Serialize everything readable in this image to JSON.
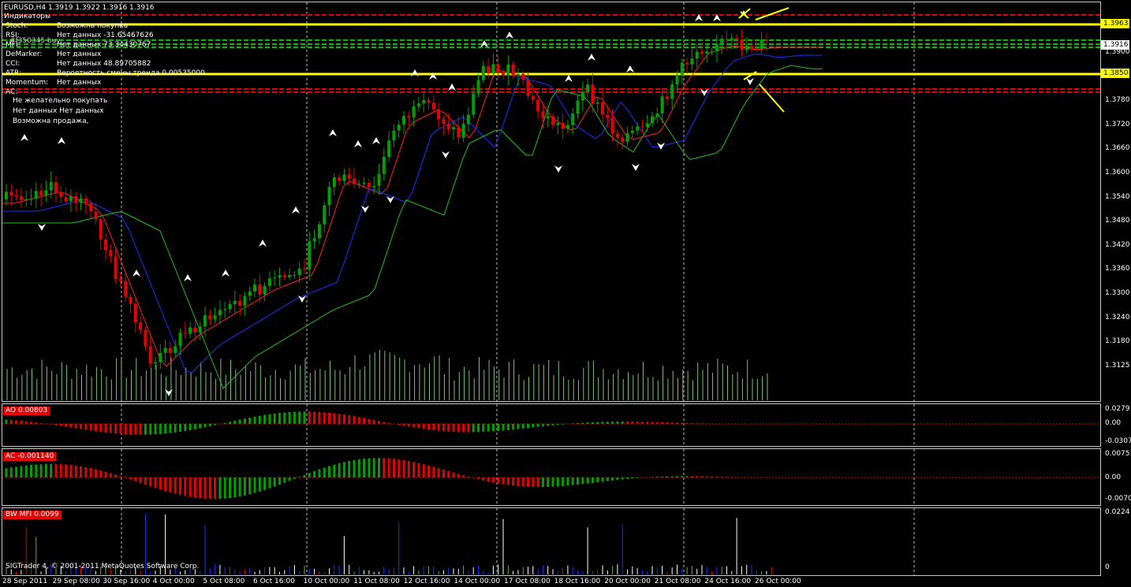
{
  "header": {
    "symbol_line": "EURUSD,H4  1.3919 1.3922 1.3916 1.3916",
    "indicators_title": "Индикаторы"
  },
  "indicator_rows": [
    {
      "name": "Stoch:",
      "value": "Возможна покупка"
    },
    {
      "name": "RSI:",
      "value": "Нет данных -31.65467626"
    },
    {
      "name": "MFI:",
      "value": "Нет данных 73.34430767"
    },
    {
      "name": "DeMarker:",
      "value": "Нет данных"
    },
    {
      "name": "CCI:",
      "value": "Нет данных 48.89705882"
    },
    {
      "name": "ATR:",
      "value": "Вероятность смены тренда 0.00535000"
    },
    {
      "name": "Momentum:",
      "value": "Нет данных"
    },
    {
      "name": "AC:",
      "value": ""
    }
  ],
  "overlay_text": "#f350345 buy",
  "advice": [
    "Не желательно покупать",
    "Нет данных Нет данных",
    "Возможна продажа,"
  ],
  "price_axis": [
    "1.3900",
    "1.3840",
    "1.3780",
    "1.3720",
    "1.3660",
    "1.3600",
    "1.3540",
    "1.3480",
    "1.3420",
    "1.3360",
    "1.3300",
    "1.3240",
    "1.3180",
    "1.3125"
  ],
  "price_boxes": {
    "level_high": "1.3963",
    "current": "1.3916",
    "level_low": "1.3850"
  },
  "ao": {
    "label": "AO 0.00803",
    "ticks": [
      "0.02791",
      "0.00",
      "-0.03076"
    ]
  },
  "ac": {
    "label": "AC -0.001140",
    "ticks": [
      "0.00751",
      "0.00",
      "-0.00706"
    ]
  },
  "bw": {
    "label": "BW MFI 0.0099",
    "ticks": [
      "0.0224",
      "0"
    ]
  },
  "dates": [
    "28 Sep 2011",
    "29 Sep 08:00",
    "30 Sep 16:00",
    "4 Oct 00:00",
    "5 Oct 08:00",
    "6 Oct 16:00",
    "10 Oct 00:00",
    "11 Oct 08:00",
    "12 Oct 16:00",
    "14 Oct 00:00",
    "17 Oct 08:00",
    "18 Oct 16:00",
    "20 Oct 00:00",
    "21 Oct 08:00",
    "24 Oct 16:00",
    "26 Oct 00:00"
  ],
  "copyright": "SIGTrader 4, © 2001-2011 MetaQuotes Software Corp.",
  "colors": {
    "bull": "#00a000",
    "bear": "#e60000",
    "ma_fast": "#ff2020",
    "ma_mid": "#2030ff",
    "ma_slow": "#20c020",
    "level": "#ffff00",
    "volume": "#7fbf7f"
  }
}
